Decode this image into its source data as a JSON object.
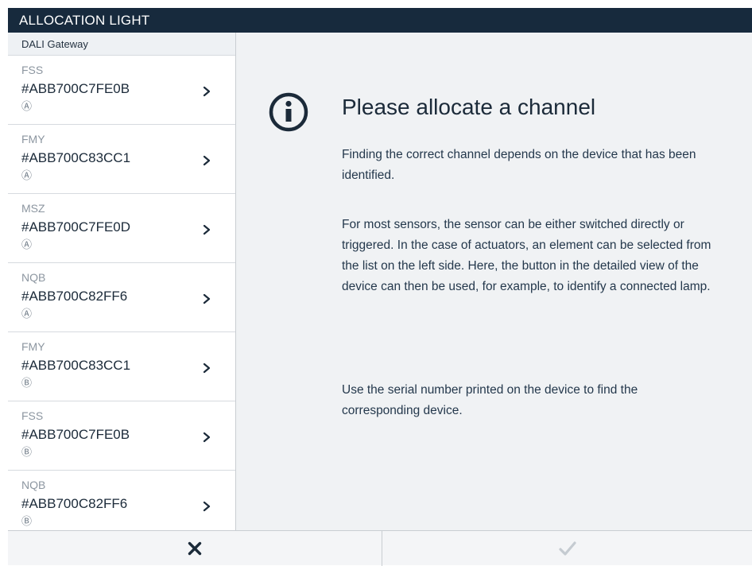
{
  "header": {
    "title": "ALLOCATION LIGHT"
  },
  "sidebar": {
    "header": "DALI Gateway",
    "items": [
      {
        "type": "FSS",
        "id": "#ABB700C7FE0B",
        "channel": "Ⓐ"
      },
      {
        "type": "FMY",
        "id": "#ABB700C83CC1",
        "channel": "Ⓐ"
      },
      {
        "type": "MSZ",
        "id": "#ABB700C7FE0D",
        "channel": "Ⓐ"
      },
      {
        "type": "NQB",
        "id": "#ABB700C82FF6",
        "channel": "Ⓐ"
      },
      {
        "type": "FMY",
        "id": "#ABB700C83CC1",
        "channel": "Ⓑ"
      },
      {
        "type": "FSS",
        "id": "#ABB700C7FE0B",
        "channel": "Ⓑ"
      },
      {
        "type": "NQB",
        "id": "#ABB700C82FF6",
        "channel": "Ⓑ"
      }
    ]
  },
  "main": {
    "icon": "info-icon",
    "title": "Please allocate a channel",
    "paragraphs": [
      "Finding the correct channel depends on the device that has been identified.",
      "For most sensors, the sensor can be either switched directly or triggered. In the case of actuators, an element can be selected from the list on the left side. Here, the button in the detailed view of the device can then be used, for example, to identify a connected lamp.",
      "Use the serial number printed on the device to find the corresponding device."
    ]
  },
  "footer": {
    "cancel_icon": "close-icon",
    "confirm_icon": "check-icon"
  },
  "colors": {
    "titlebar": "#172a3d",
    "main_bg": "#f0f2f4",
    "text": "#1b2a39",
    "disabled_check": "#c5cbd1"
  }
}
